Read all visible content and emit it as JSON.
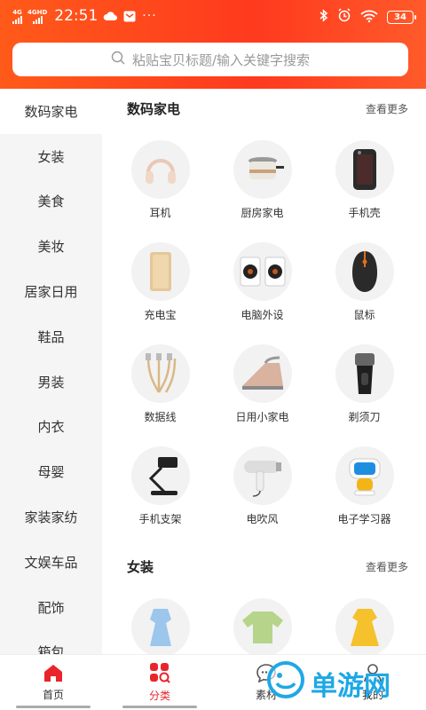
{
  "status_bar": {
    "network1": "4G",
    "network2": "4GHD",
    "time": "22:51",
    "more": "···",
    "battery": "34"
  },
  "search": {
    "placeholder": "粘贴宝贝标题/输入关键字搜索"
  },
  "sidebar": {
    "items": [
      {
        "label": "数码家电",
        "active": true
      },
      {
        "label": "女装"
      },
      {
        "label": "美食"
      },
      {
        "label": "美妆"
      },
      {
        "label": "居家日用"
      },
      {
        "label": "鞋品"
      },
      {
        "label": "男装"
      },
      {
        "label": "内衣"
      },
      {
        "label": "母婴"
      },
      {
        "label": "家装家纺"
      },
      {
        "label": "文娱车品"
      },
      {
        "label": "配饰"
      },
      {
        "label": "箱包"
      }
    ]
  },
  "sections": [
    {
      "title": "数码家电",
      "more": "查看更多",
      "items": [
        {
          "label": "耳机",
          "icon": "headphones-icon"
        },
        {
          "label": "厨房家电",
          "icon": "cooker-icon"
        },
        {
          "label": "手机壳",
          "icon": "phone-case-icon"
        },
        {
          "label": "充电宝",
          "icon": "power-bank-icon"
        },
        {
          "label": "电脑外设",
          "icon": "speakers-icon"
        },
        {
          "label": "鼠标",
          "icon": "mouse-icon"
        },
        {
          "label": "数据线",
          "icon": "cable-icon"
        },
        {
          "label": "日用小家电",
          "icon": "iron-icon"
        },
        {
          "label": "剃须刀",
          "icon": "shaver-icon"
        },
        {
          "label": "手机支架",
          "icon": "phone-stand-icon"
        },
        {
          "label": "电吹风",
          "icon": "hair-dryer-icon"
        },
        {
          "label": "电子学习器",
          "icon": "learning-robot-icon"
        }
      ]
    },
    {
      "title": "女装",
      "more": "查看更多",
      "items": [
        {
          "label": "",
          "icon": "dress-blue-icon"
        },
        {
          "label": "",
          "icon": "top-green-icon"
        },
        {
          "label": "",
          "icon": "dress-yellow-icon"
        }
      ]
    }
  ],
  "tabbar": {
    "items": [
      {
        "label": "首页",
        "icon": "home-icon"
      },
      {
        "label": "分类",
        "icon": "category-icon",
        "active": true
      },
      {
        "label": "素材",
        "icon": "chat-icon"
      },
      {
        "label": "我的",
        "icon": "user-icon"
      }
    ]
  },
  "watermark": {
    "text": "单游网"
  },
  "colors": {
    "header": "#ff4a1e",
    "accent": "#e9252b",
    "sidebar_bg": "#f5f5f5"
  }
}
